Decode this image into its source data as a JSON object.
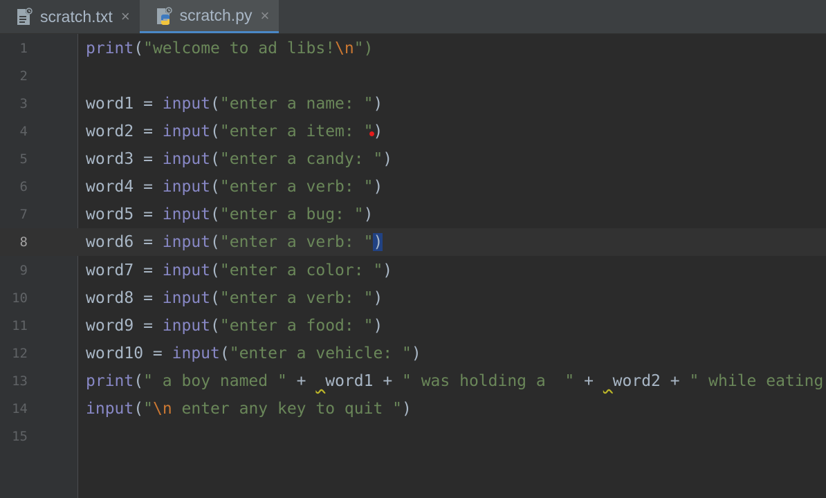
{
  "tabs": [
    {
      "label": "scratch.txt",
      "icon": "text-file-icon",
      "active": false
    },
    {
      "label": "scratch.py",
      "icon": "python-file-icon",
      "active": true
    }
  ],
  "close_glyph": "×",
  "current_line": 8,
  "lines": [
    {
      "num": "1"
    },
    {
      "num": "2"
    },
    {
      "num": "3"
    },
    {
      "num": "4"
    },
    {
      "num": "5"
    },
    {
      "num": "6"
    },
    {
      "num": "7"
    },
    {
      "num": "8"
    },
    {
      "num": "9"
    },
    {
      "num": "10"
    },
    {
      "num": "11"
    },
    {
      "num": "12"
    },
    {
      "num": "13"
    },
    {
      "num": "14"
    },
    {
      "num": "15"
    }
  ],
  "code": {
    "l1": [
      "print",
      "(",
      "\"welcome to ad libs!",
      "\\n",
      "\")"
    ],
    "l3": [
      "word1 = ",
      "input",
      "(",
      "\"enter a name: \"",
      ")"
    ],
    "l4": [
      "word2 = ",
      "input",
      "(",
      "\"enter a item: \"",
      ")"
    ],
    "l5": [
      "word3 = ",
      "input",
      "(",
      "\"enter a candy: \"",
      ")"
    ],
    "l6": [
      "word4 = ",
      "input",
      "(",
      "\"enter a verb: \"",
      ")"
    ],
    "l7": [
      "word5 = ",
      "input",
      "(",
      "\"enter a bug: \"",
      ")"
    ],
    "l8": [
      "word6 = ",
      "input",
      "(",
      "\"enter a verb: \"",
      ")"
    ],
    "l9": [
      "word7 = ",
      "input",
      "(",
      "\"enter a color: \"",
      ")"
    ],
    "l10": [
      "word8 = ",
      "input",
      "(",
      "\"enter a verb: \"",
      ")"
    ],
    "l11": [
      "word9 = ",
      "input",
      "(",
      "\"enter a food: \"",
      ")"
    ],
    "l12": [
      "word10 = ",
      "input",
      "(",
      "\"enter a vehicle: \"",
      ")"
    ],
    "l13": [
      "print",
      "(",
      "\" a boy named \"",
      " + ",
      " ",
      "word1 + ",
      "\" was holding a  \"",
      " + ",
      " ",
      "word2 + ",
      "\" while eating"
    ],
    "l14": [
      "input",
      "(",
      "\"",
      "\\n",
      " enter any key to quit \"",
      ")"
    ]
  },
  "colors": {
    "background": "#2b2b2b",
    "gutter": "#313335",
    "builtin": "#8888c6",
    "string": "#6a8759",
    "escape": "#cc7832",
    "text": "#a9b7c6",
    "line_number": "#606366",
    "selection": "#214283",
    "active_tab_underline": "#4a88c7"
  }
}
